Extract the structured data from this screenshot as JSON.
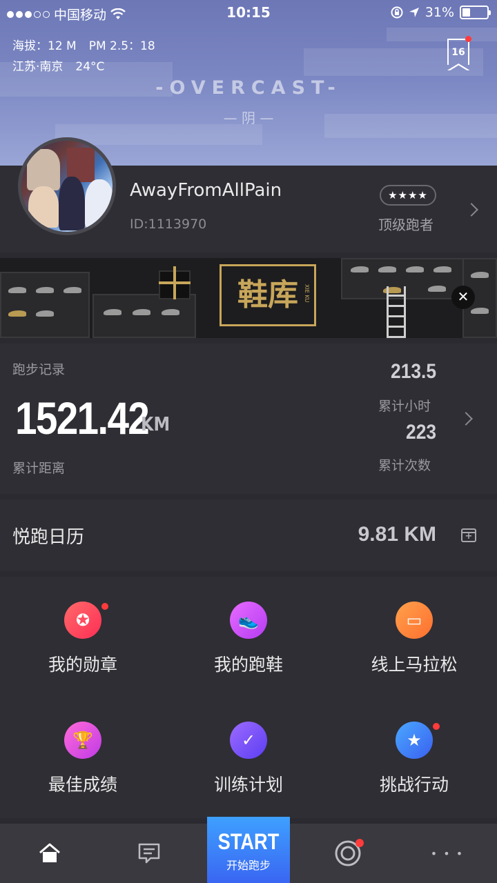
{
  "status_bar": {
    "carrier": "中国移动",
    "time": "10:15",
    "battery": "31%",
    "battery_level": 0.31
  },
  "weather": {
    "altitude": "海拔：12 M",
    "pm25": "PM 2.5：18",
    "location": "江苏·南京",
    "temperature": "24°C",
    "condition_en": "-OVERCAST-",
    "condition_cn": "— 阴 —",
    "badge_day": "16"
  },
  "profile": {
    "username": "AwayFromAllPain",
    "user_id": "ID:1113970",
    "stars": "★★★★",
    "rank": "顶级跑者"
  },
  "banner": {
    "title": "鞋库",
    "subtitle": "XIE KU",
    "close_glyph": "✕"
  },
  "record": {
    "section_title": "跑步记录",
    "total_distance": "1521.42",
    "distance_unit": "KM",
    "distance_label": "累计距离",
    "total_hours": "213.5",
    "hours_label": "累计小时",
    "total_runs": "223",
    "runs_label": "累计次数"
  },
  "calendar": {
    "title": "悦跑日历",
    "today_km": "9.81 KM"
  },
  "grid": [
    {
      "label": "我的勋章",
      "icon": "medal-icon",
      "glyph": "✪",
      "color_from": "#ff6a6a",
      "color_to": "#ff2e55",
      "badge": true
    },
    {
      "label": "我的跑鞋",
      "icon": "shoe-icon",
      "glyph": "👟",
      "color_from": "#e86bff",
      "color_to": "#b43cf2",
      "badge": false
    },
    {
      "label": "线上马拉松",
      "icon": "bib-icon",
      "glyph": "▭",
      "color_from": "#ffa14d",
      "color_to": "#ff6f2e",
      "badge": false
    },
    {
      "label": "最佳成绩",
      "icon": "trophy-icon",
      "glyph": "🏆",
      "color_from": "#ff6bd8",
      "color_to": "#c03ae6",
      "badge": false
    },
    {
      "label": "训练计划",
      "icon": "check-icon",
      "glyph": "✓",
      "color_from": "#9d6bff",
      "color_to": "#5b3ef2",
      "badge": false
    },
    {
      "label": "挑战行动",
      "icon": "star-icon",
      "glyph": "★",
      "color_from": "#4aa8ff",
      "color_to": "#3a60f0",
      "badge": true
    }
  ],
  "tabbar": {
    "start_en": "START",
    "start_cn": "开始跑步",
    "more_glyph": "• • •"
  },
  "colors": {
    "accent_red": "#ff3b3b",
    "start_blue": "#3a80f5",
    "panel": "#2f2e34"
  }
}
